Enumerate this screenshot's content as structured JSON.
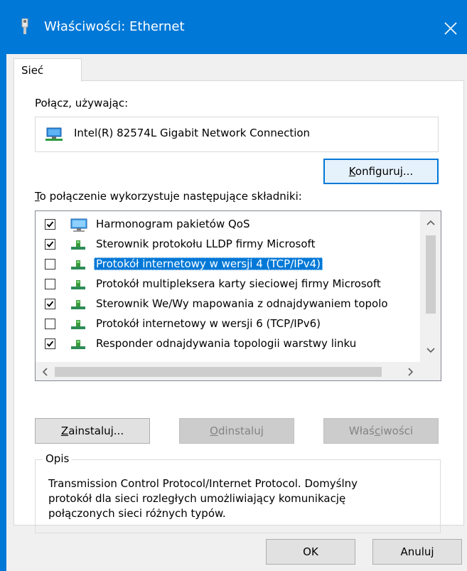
{
  "window": {
    "title": "Właściwości: Ethernet",
    "accent": "#0078d7"
  },
  "tabs": [
    {
      "label": "Sieć"
    }
  ],
  "connect_using": {
    "label": "Połącz, używając:",
    "adapter": "Intel(R) 82574L Gigabit Network Connection",
    "adapter_icon": "network-adapter-icon"
  },
  "buttons": {
    "configure": {
      "before": "",
      "key": "K",
      "after": "onfiguruj..."
    },
    "install": {
      "before": "",
      "key": "Z",
      "after": "ainstaluj..."
    },
    "uninstall": {
      "before": "",
      "key": "O",
      "after": "dinstaluj"
    },
    "properties": {
      "before": "Właś",
      "key": "c",
      "after": "iwości"
    },
    "ok": "OK",
    "cancel": "Anuluj"
  },
  "components": {
    "label": {
      "key": "T",
      "after": "o połączenie wykorzystuje następujące składniki:"
    },
    "items": [
      {
        "checked": true,
        "label": "Harmonogram pakietów QoS",
        "icon": "qos-service-icon"
      },
      {
        "checked": true,
        "label": "Sterownik protokołu LLDP firmy Microsoft",
        "icon": "protocol-icon"
      },
      {
        "checked": false,
        "label": "Protokół internetowy w wersji 4 (TCP/IPv4)",
        "icon": "protocol-icon",
        "selected": true
      },
      {
        "checked": false,
        "label": "Protokół multipleksera karty sieciowej firmy Microsoft",
        "icon": "protocol-icon"
      },
      {
        "checked": true,
        "label": "Sterownik We/Wy mapowania z odnajdywaniem topolo",
        "icon": "protocol-icon"
      },
      {
        "checked": false,
        "label": "Protokół internetowy w wersji 6 (TCP/IPv6)",
        "icon": "protocol-icon"
      },
      {
        "checked": true,
        "label": "Responder odnajdywania topologii warstwy linku",
        "icon": "protocol-icon"
      }
    ]
  },
  "description": {
    "title": "Opis",
    "lines": [
      "Transmission Control Protocol/Internet Protocol. Domyślny",
      "protokół dla sieci rozległych umożliwiający komunikację",
      "połączonych sieci różnych typów."
    ]
  }
}
